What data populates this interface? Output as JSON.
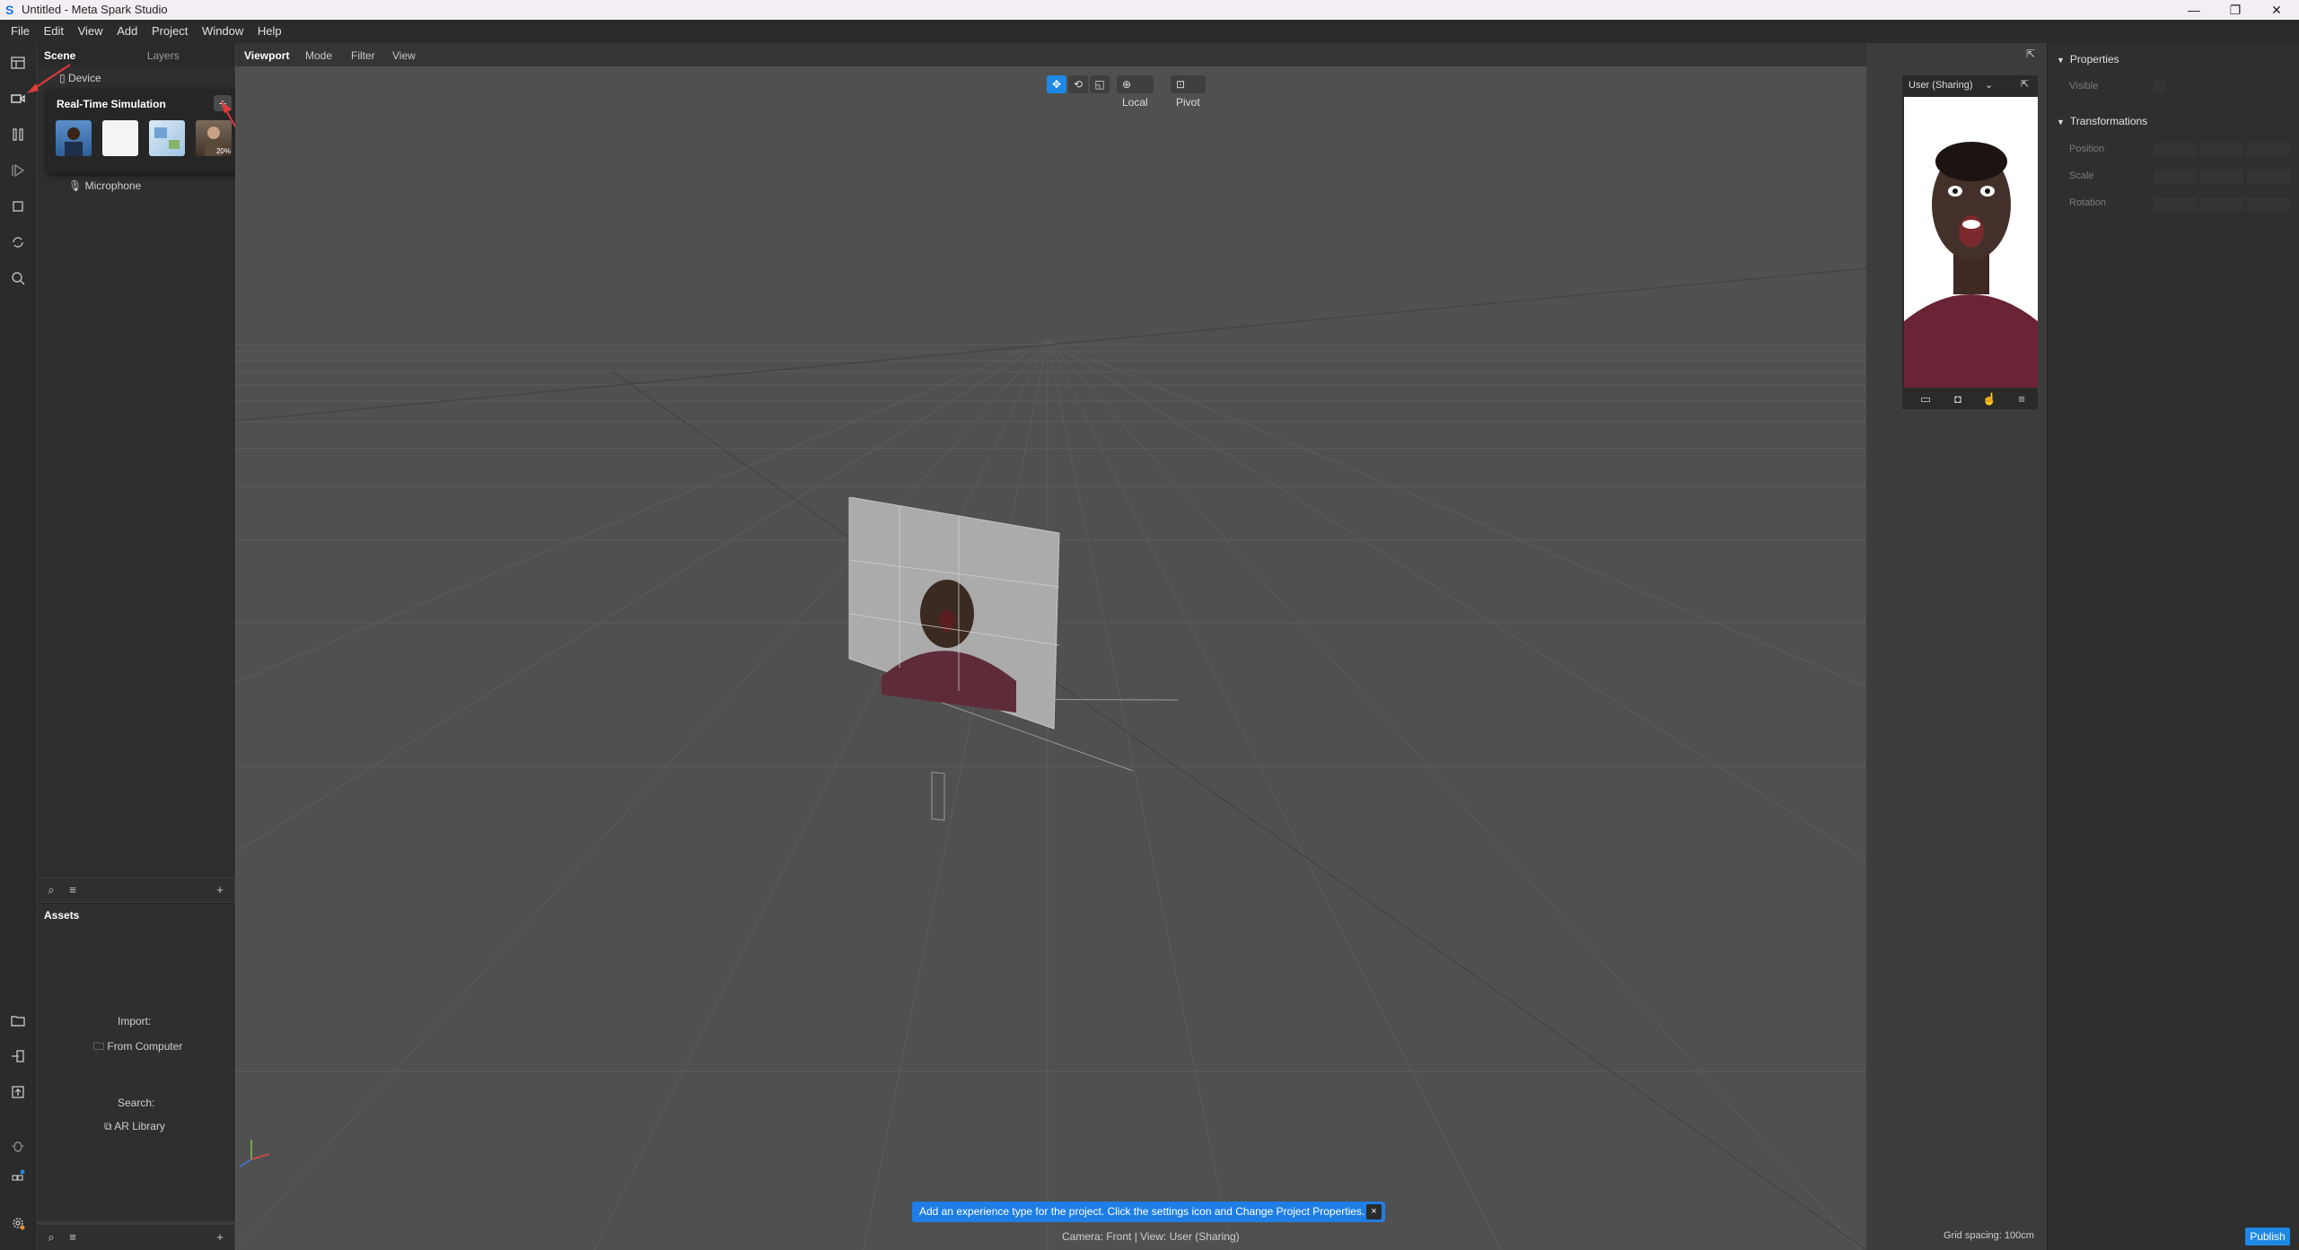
{
  "window": {
    "title": "Untitled - Meta Spark Studio",
    "logo_glyph": "S"
  },
  "menu": [
    "File",
    "Edit",
    "View",
    "Add",
    "Project",
    "Window",
    "Help"
  ],
  "scene_panel": {
    "tabs": [
      "Scene",
      "Layers"
    ],
    "items": {
      "device": "Device",
      "microphone": "Microphone"
    }
  },
  "simulation_popup": {
    "title": "Real-Time Simulation",
    "add_label": "+",
    "thumb_badge": "20%"
  },
  "assets": {
    "title": "Assets",
    "import_label": "Import:",
    "from_computer": "From Computer",
    "search_label": "Search:",
    "ar_library": "AR Library"
  },
  "viewport": {
    "tabs": [
      "Viewport",
      "Mode",
      "Filter",
      "View"
    ],
    "toolbar": {
      "local": "Local",
      "pivot": "Pivot"
    },
    "preview_label": "User (Sharing)",
    "notification": "Add an experience type for the project. Click the settings icon and Change Project Properties.",
    "notification_close": "×",
    "camera_status": "Camera: Front | View: User (Sharing)",
    "grid_spacing": "Grid spacing: 100cm"
  },
  "properties": {
    "title": "Properties",
    "visible_label": "Visible",
    "transformations": "Transformations",
    "position": "Position",
    "scale": "Scale",
    "rotation": "Rotation"
  },
  "publish_label": "Publish",
  "colors": {
    "accent": "#1e88e5",
    "viewport_bg": "#505050",
    "panel_bg": "#2f2f2f"
  }
}
